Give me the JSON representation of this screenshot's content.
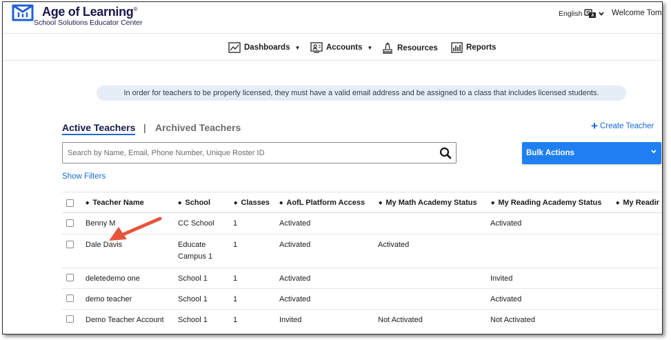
{
  "header": {
    "brand_title": "Age of Learning",
    "brand_sup": "®",
    "brand_subtitle": "School Solutions Educator Center",
    "language": "English",
    "welcome": "Welcome Tom"
  },
  "nav": {
    "items": [
      {
        "label": "Dashboards",
        "icon": "dashboard-chart-icon",
        "dropdown": true
      },
      {
        "label": "Accounts",
        "icon": "accounts-icon",
        "dropdown": true
      },
      {
        "label": "Resources",
        "icon": "resources-icon",
        "dropdown": false
      },
      {
        "label": "Reports",
        "icon": "reports-icon",
        "dropdown": false
      }
    ]
  },
  "banner": {
    "text": "In order for teachers to be properly licensed, they must have a valid email address and be assigned to a class that includes licensed students."
  },
  "tabs": {
    "active": "Active Teachers",
    "separator": "|",
    "archived": "Archived Teachers"
  },
  "actions": {
    "create_teacher": "Create Teacher",
    "search_placeholder": "Search by Name, Email, Phone Number, Unique Roster ID",
    "bulk_actions": "Bulk Actions",
    "show_filters": "Show Filters"
  },
  "table": {
    "columns": [
      "Teacher Name",
      "School",
      "Classes",
      "AofL Platform Access",
      "My Math Academy Status",
      "My Reading Academy Status",
      "My Readir"
    ],
    "rows": [
      {
        "name": "Benny M",
        "school": "CC School",
        "school2": "",
        "classes": "1",
        "access": "Activated",
        "math": "",
        "reading": "Activated"
      },
      {
        "name": "Dale Davis",
        "school": "Educate",
        "school2": "Campus 1",
        "classes": "1",
        "access": "Activated",
        "math": "Activated",
        "reading": ""
      },
      {
        "name": "deletedemo one",
        "school": "School 1",
        "school2": "",
        "classes": "1",
        "access": "Activated",
        "math": "",
        "reading": "Invited"
      },
      {
        "name": "demo teacher",
        "school": "School 1",
        "school2": "",
        "classes": "1",
        "access": "Activated",
        "math": "",
        "reading": "Activated"
      },
      {
        "name": "Demo Teacher Account",
        "school": "School 1",
        "school2": "",
        "classes": "1",
        "access": "Invited",
        "math": "Not Activated",
        "reading": "Not Activated"
      }
    ]
  },
  "colors": {
    "brand_navy": "#17174a",
    "link_blue": "#1769d6",
    "button_blue": "#1f7ff2",
    "banner_bg": "#e5eef7",
    "arrow_red": "#e5553d"
  }
}
